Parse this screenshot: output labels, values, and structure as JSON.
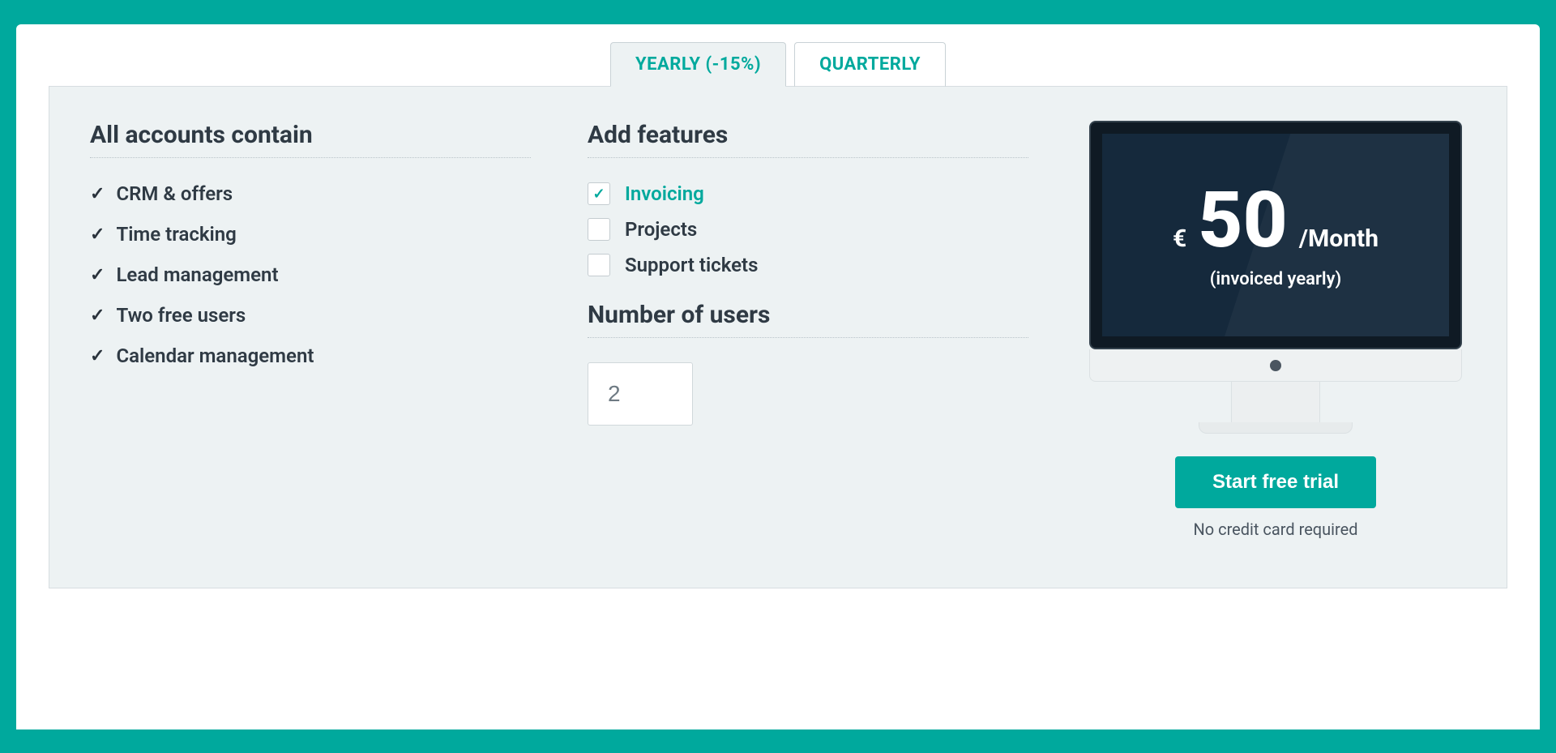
{
  "tabs": {
    "yearly": "YEARLY (-15%)",
    "quarterly": "QUARTERLY",
    "selected": "yearly"
  },
  "sections": {
    "included_title": "All accounts contain",
    "addons_title": "Add features",
    "users_title": "Number of users"
  },
  "included": [
    "CRM & offers",
    "Time tracking",
    "Lead management",
    "Two free users",
    "Calendar management"
  ],
  "addons": [
    {
      "label": "Invoicing",
      "selected": true
    },
    {
      "label": "Projects",
      "selected": false
    },
    {
      "label": "Support tickets",
      "selected": false
    }
  ],
  "users_value": "2",
  "price": {
    "currency": "€",
    "amount": "50",
    "per": "/Month",
    "billing_note": "(invoiced yearly)"
  },
  "cta": {
    "button": "Start free trial",
    "note": "No credit card required"
  },
  "colors": {
    "accent": "#00a99d",
    "text": "#2f3a44",
    "panel": "#edf2f3"
  }
}
